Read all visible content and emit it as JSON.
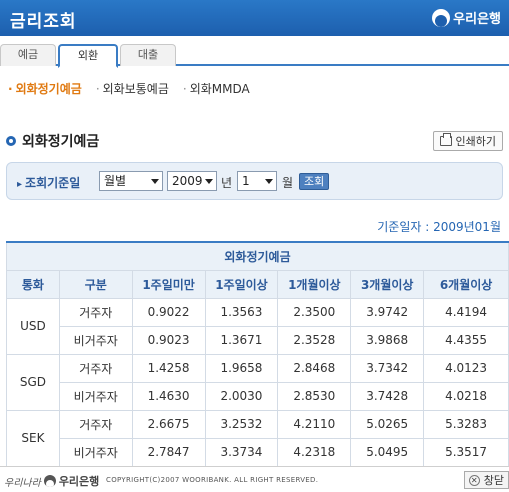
{
  "header": {
    "title": "금리조회",
    "brand": "우리은행"
  },
  "tabs": [
    {
      "label": "예금"
    },
    {
      "label": "외환"
    },
    {
      "label": "대출"
    }
  ],
  "subnav": [
    {
      "label": "외화정기예금"
    },
    {
      "label": "외화보통예금"
    },
    {
      "label": "외화MMDA"
    }
  ],
  "section": {
    "title": "외화정기예금",
    "print_label": "인쇄하기"
  },
  "search": {
    "label": "조회기준일",
    "period_value": "월별",
    "year_value": "2009",
    "year_unit": "년",
    "month_value": "1",
    "month_unit": "월",
    "submit_label": "조회"
  },
  "base_date": "기준일자 : 2009년01월",
  "table": {
    "group_header": "외화정기예금",
    "headers": [
      "통화",
      "구분",
      "1주일미만",
      "1주일이상",
      "1개월이상",
      "3개월이상",
      "6개월이상"
    ],
    "rows": [
      {
        "currency": "USD",
        "type": "거주자",
        "v": [
          "0.9022",
          "1.3563",
          "2.3500",
          "3.9742",
          "4.4194"
        ]
      },
      {
        "currency": "",
        "type": "비거주자",
        "v": [
          "0.9023",
          "1.3671",
          "2.3528",
          "3.9868",
          "4.4355"
        ]
      },
      {
        "currency": "SGD",
        "type": "거주자",
        "v": [
          "1.4258",
          "1.9658",
          "2.8468",
          "3.7342",
          "4.0123"
        ]
      },
      {
        "currency": "",
        "type": "비거주자",
        "v": [
          "1.4630",
          "2.0030",
          "2.8530",
          "3.7428",
          "4.0218"
        ]
      },
      {
        "currency": "SEK",
        "type": "거주자",
        "v": [
          "2.6675",
          "3.2532",
          "4.2110",
          "5.0265",
          "5.3283"
        ]
      },
      {
        "currency": "",
        "type": "비거주자",
        "v": [
          "2.7847",
          "3.3734",
          "4.2318",
          "5.0495",
          "5.3517"
        ]
      }
    ]
  },
  "footer": {
    "slogan": "우리나라",
    "brand": "우리은행",
    "copyright": "COPYRIGHT(C)2007 WOORIBANK. ALL RIGHT RESERVED.",
    "close_label": "창닫"
  }
}
